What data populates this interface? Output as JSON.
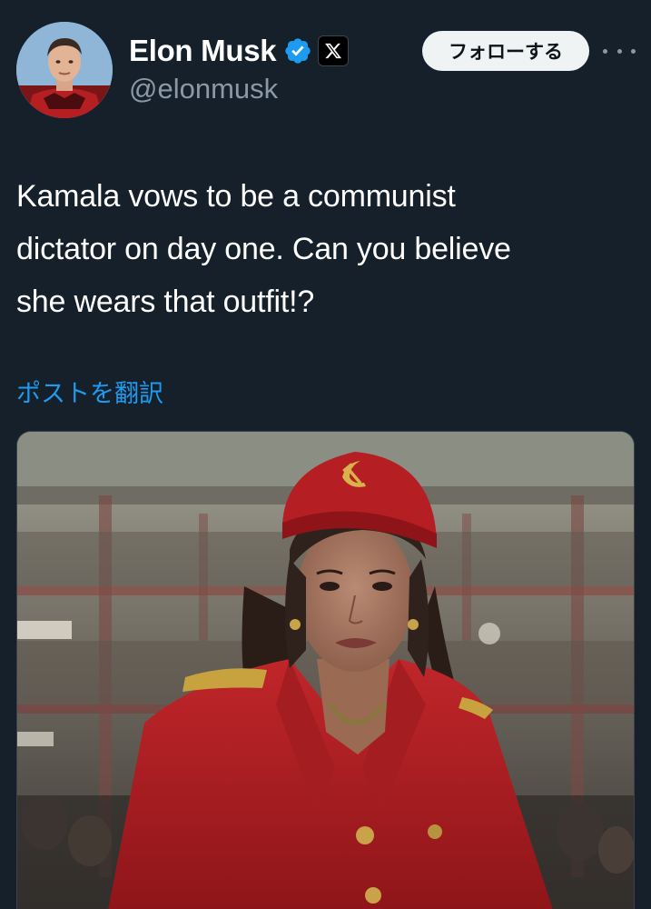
{
  "author": {
    "display_name": "Elon Musk",
    "handle": "@elonmusk",
    "avatar_icon": "profile-photo",
    "verified_icon": "verified-badge-icon",
    "affiliation_icon": "x-logo-icon"
  },
  "actions": {
    "follow_label": "フォローする",
    "more_icon": "more-options-icon"
  },
  "tweet": {
    "text": "Kamala vows to be a communist\ndictator on day one. Can you believe\nshe wears that outfit!?",
    "translate_label": "ポストを翻訳"
  },
  "media": {
    "type": "photo",
    "icon": "hammer-and-sickle-icon"
  },
  "colors": {
    "background": "#15202b",
    "text_primary": "#ffffff",
    "text_secondary": "#8b98a5",
    "link": "#1d9bf0",
    "verified": "#1d9bf0",
    "follow_button_bg": "#eff3f4"
  }
}
